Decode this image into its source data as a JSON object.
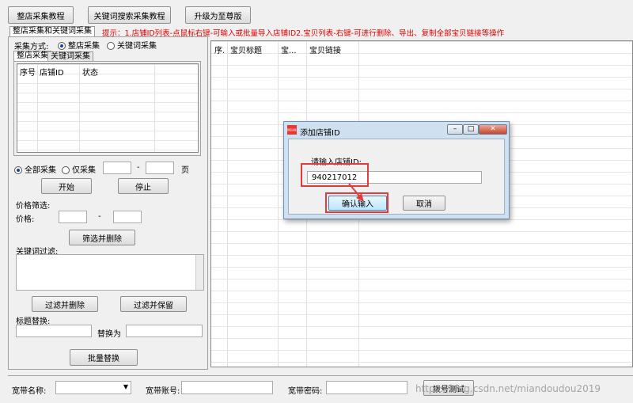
{
  "top_buttons": [
    "整店采集教程",
    "关键词搜索采集教程",
    "升级为至尊版"
  ],
  "main_tabs": [
    "整店采集和关键词采集"
  ],
  "hint": "提示：1.店铺ID列表-点鼠标右键-可输入或批量导入店铺ID2.宝贝列表-右键-可进行删除、导出、复制全部宝贝链接等操作",
  "collect_mode": {
    "label": "采集方式:",
    "options": [
      "整店采集",
      "关键词采集"
    ],
    "selected": "整店采集"
  },
  "sub_tabs": [
    "整店采集",
    "关键词采集"
  ],
  "shop_table": {
    "columns": [
      "序号",
      "店铺ID",
      "状态"
    ]
  },
  "collect_range": {
    "options": [
      "全部采集",
      "仅采集"
    ],
    "selected": "全部采集",
    "dash": "-",
    "unit": "页"
  },
  "buttons": {
    "start": "开始",
    "stop": "停止",
    "filter_delete": "筛选并删除",
    "filter_kw_delete": "过滤并删除",
    "filter_kw_keep": "过滤并保留",
    "batch_replace": "批量替换"
  },
  "price": {
    "section": "价格筛选:",
    "label": "价格:",
    "dash": "-"
  },
  "keyword_filter_label": "关键词过滤:",
  "title_replace": {
    "label": "标题替换:",
    "replace_with": "替换为"
  },
  "item_table": {
    "columns": [
      "序.",
      "宝贝标题",
      "宝...",
      "宝贝链接"
    ]
  },
  "dialog": {
    "title": "添加店铺ID",
    "prompt": "请输入店铺ID:",
    "value": "940217012",
    "confirm": "确认输入",
    "cancel": "取消",
    "icon_text": "微店采集"
  },
  "bottom": {
    "broadband_name": "宽带名称:",
    "broadband_account": "宽带账号:",
    "broadband_password": "宽带密码:",
    "dial_test": "拨号测试"
  },
  "watermark": "https://blog.csdn.net/miandoudou2019"
}
